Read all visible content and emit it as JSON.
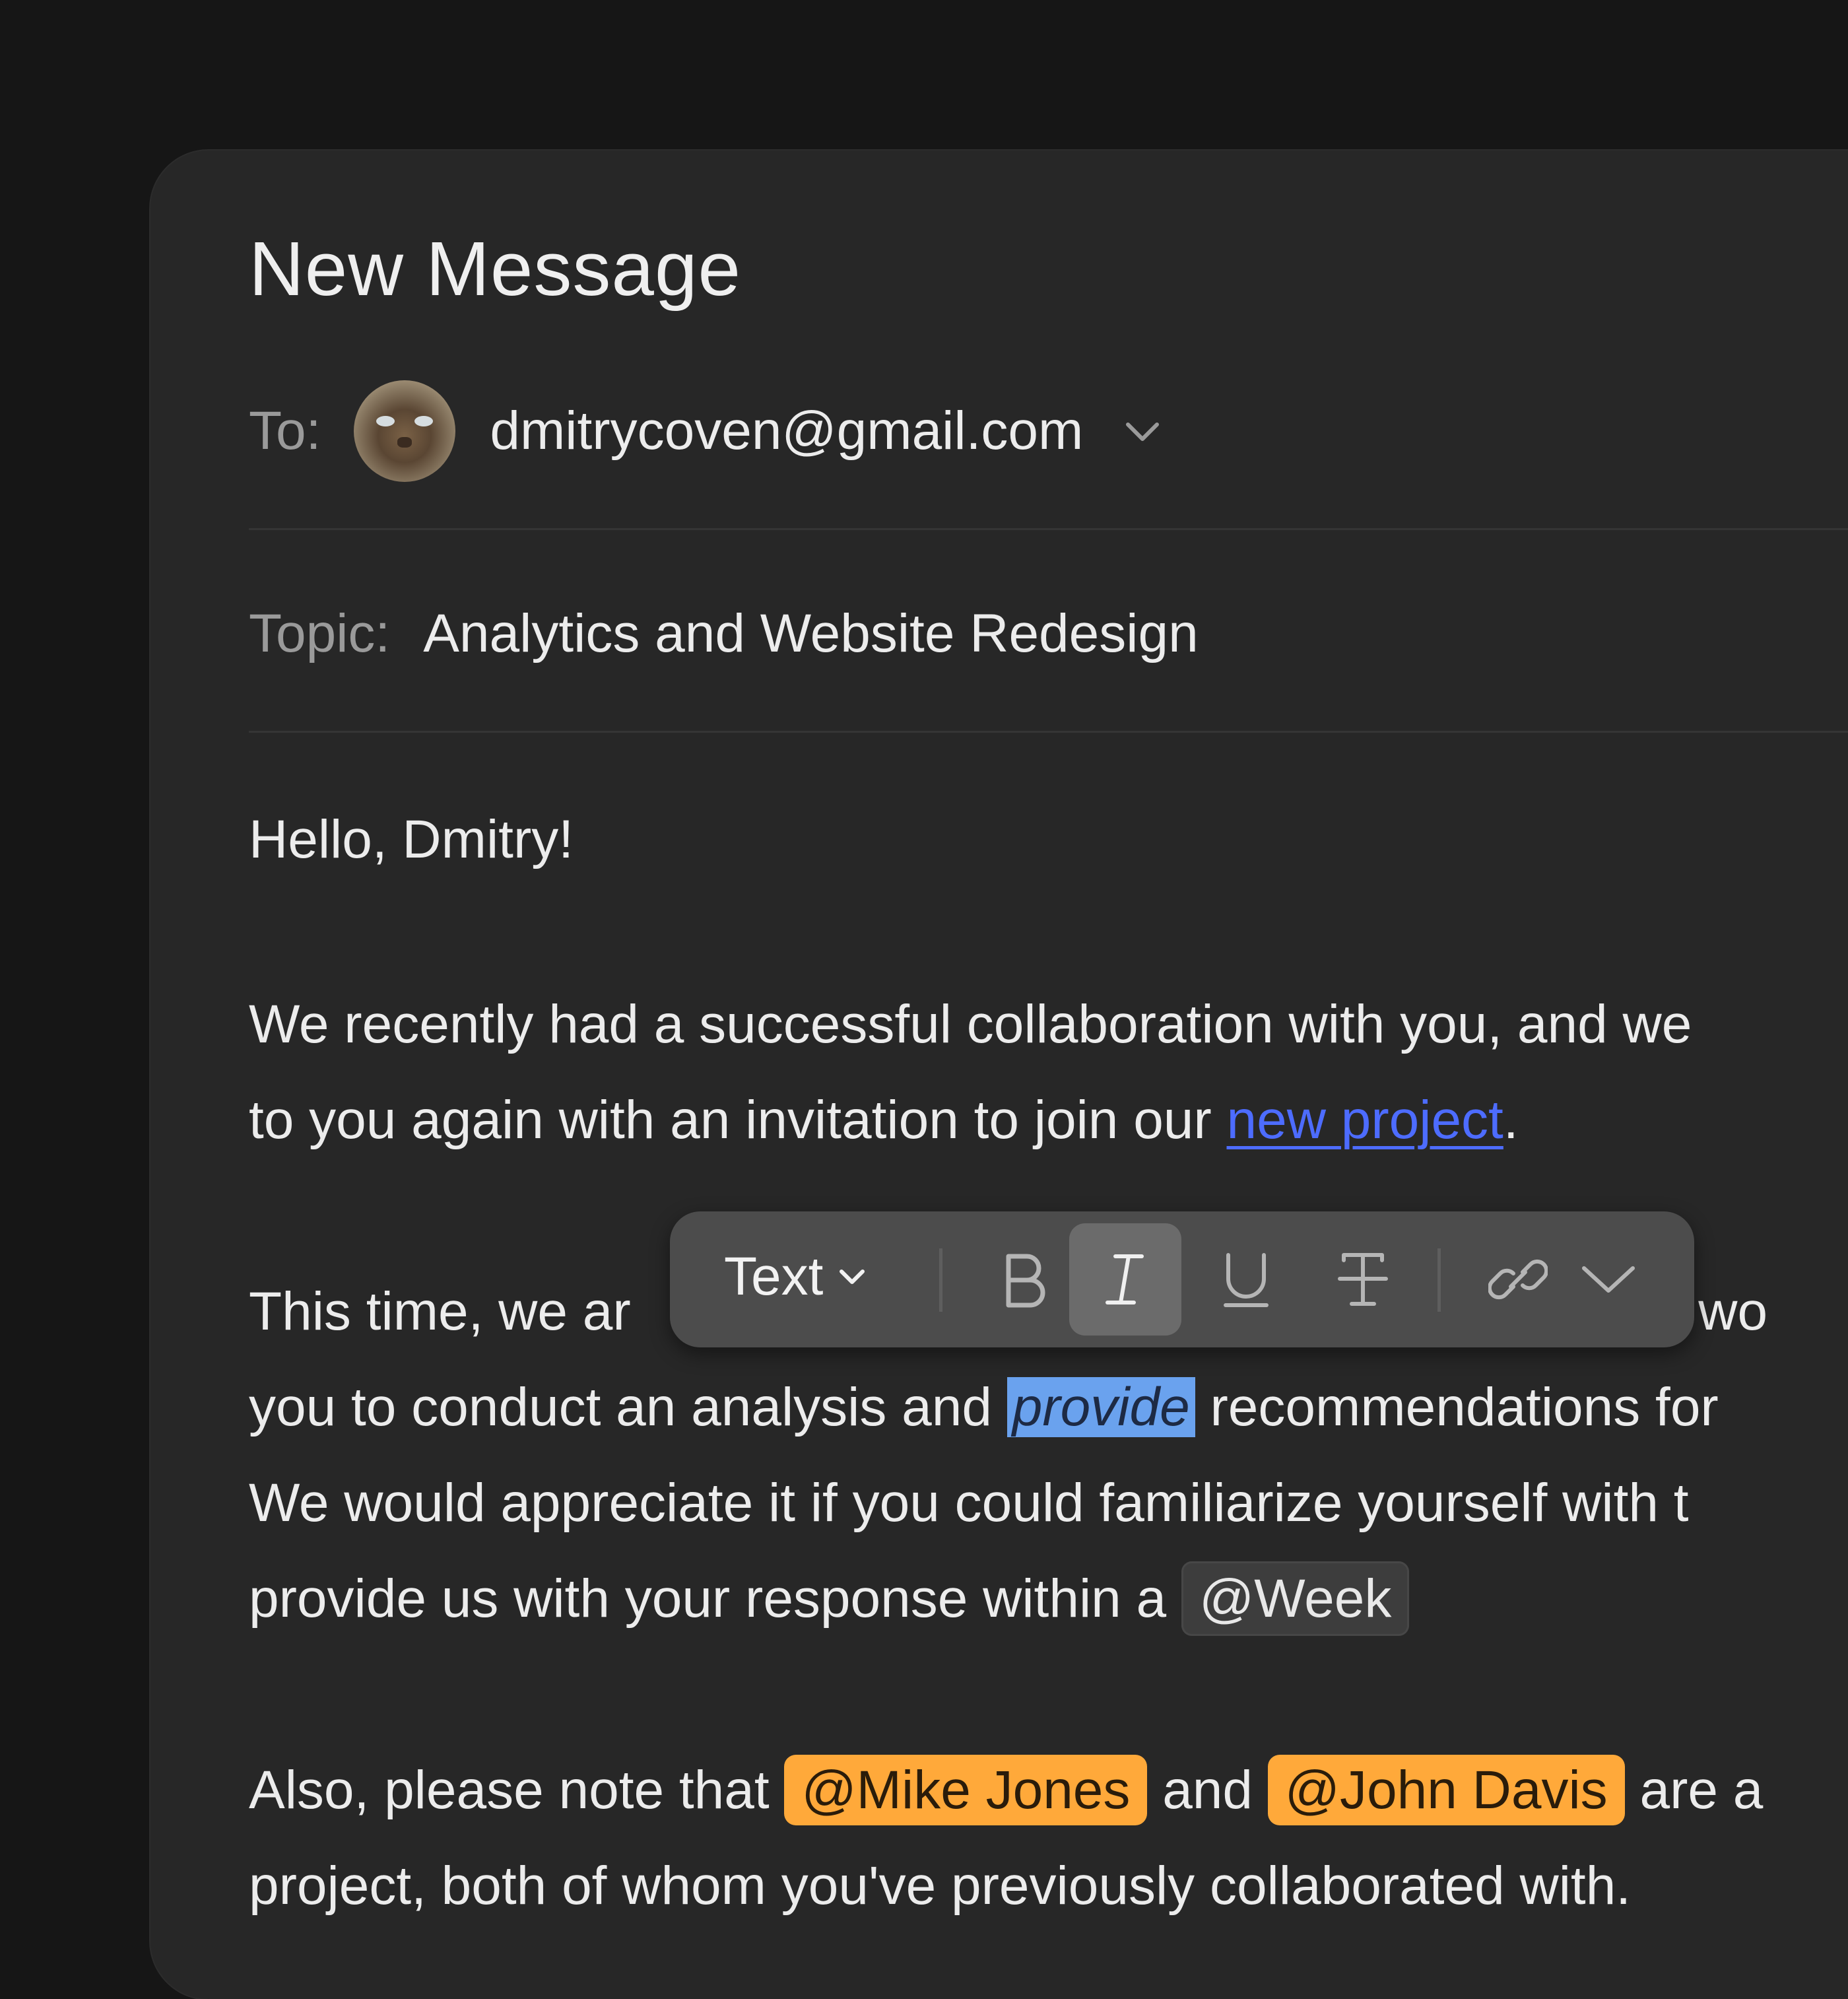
{
  "window": {
    "title": "New Message"
  },
  "to": {
    "label": "To:",
    "recipient": "dmitrycoven@gmail.com"
  },
  "topic": {
    "label": "Topic:",
    "value": "Analytics and Website Redesign"
  },
  "body": {
    "greeting": "Hello, Dmitry!",
    "line1": "We recently had a successful collaboration with you, and we",
    "line2_pre": "to you again with an invitation to join our ",
    "line2_link": "new project",
    "line2_post": ".",
    "line3_pre": "This time, we ar",
    "line3_post": "we wo",
    "line4_pre": "you to conduct an analysis and ",
    "line4_selected": "provide",
    "line4_post": " recommendations for",
    "line5": "We would appreciate it if you could familiarize yourself with t",
    "line6_pre": "provide us with your response within a ",
    "line6_chip": "@Week",
    "line7_pre": "Also, please note that ",
    "line7_mention1": "@Mike Jones",
    "line7_mid": " and ",
    "line7_mention2": "@John Davis",
    "line7_post": " are a",
    "line8": "project, both of whom you've previously collaborated with."
  },
  "toolbar": {
    "style_label": "Text",
    "buttons": [
      "bold",
      "italic",
      "underline",
      "strikethrough",
      "link",
      "more"
    ],
    "active": "italic"
  },
  "colors": {
    "background": "#161616",
    "window": "#272727",
    "link": "#4d6cff",
    "selection": "#6aa2ee",
    "mention": "#ffa93a",
    "toolbar": "#4c4c4c"
  }
}
